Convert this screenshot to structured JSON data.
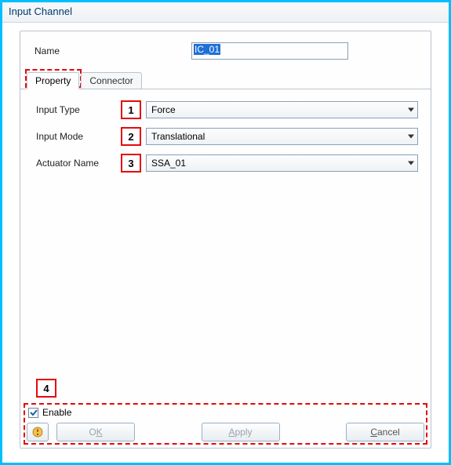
{
  "window": {
    "title": "Input Channel"
  },
  "name": {
    "label": "Name",
    "value": "IC_01"
  },
  "tabs": {
    "property": "Property",
    "connector": "Connector"
  },
  "fields": {
    "input_type": {
      "label": "Input Type",
      "value": "Force"
    },
    "input_mode": {
      "label": "Input Mode",
      "value": "Translational"
    },
    "actuator_name": {
      "label": "Actuator Name",
      "value": "SSA_01"
    }
  },
  "markers": {
    "m1": "1",
    "m2": "2",
    "m3": "3",
    "m4": "4"
  },
  "enable": {
    "label": "Enable",
    "checked": true
  },
  "buttons": {
    "ok_pre": "O",
    "ok_u": "K",
    "apply_u": "A",
    "apply_post": "pply",
    "cancel_u": "C",
    "cancel_post": "ancel"
  }
}
